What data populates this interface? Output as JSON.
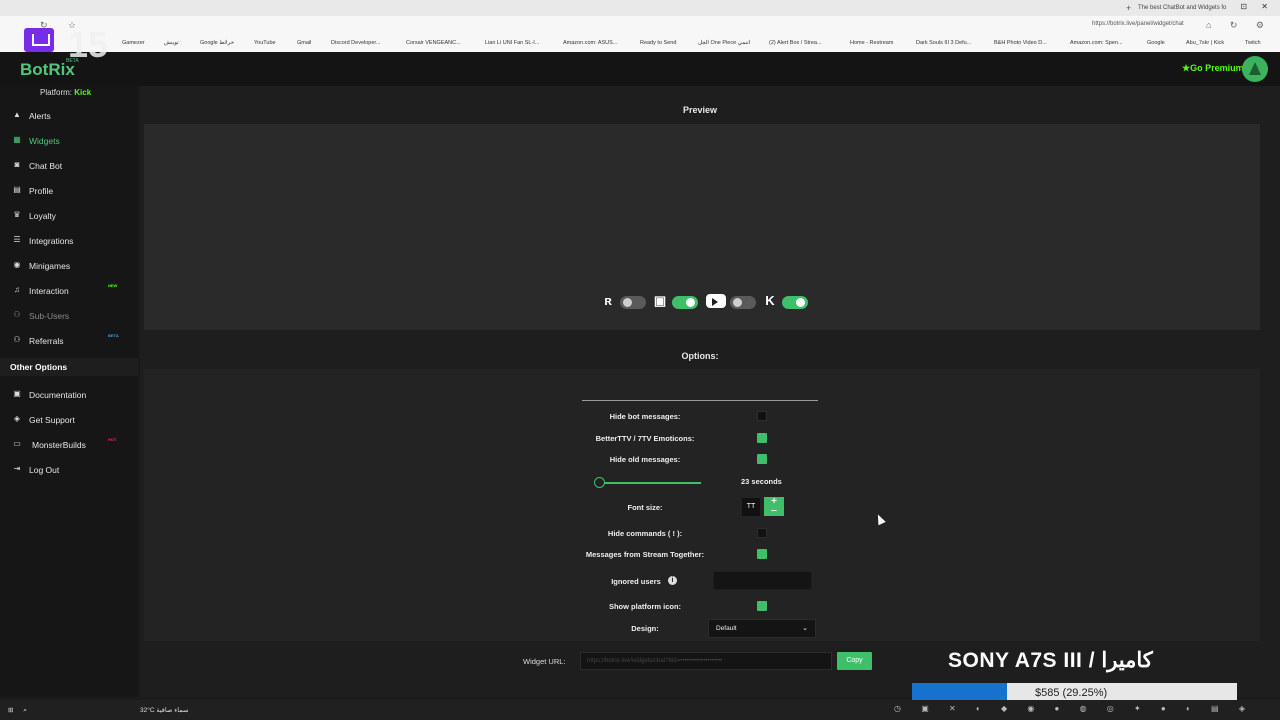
{
  "browser": {
    "active_tab": "The best ChatBot and Widgets fo",
    "url": "https://botrix.live/panel/widget/chat",
    "bookmarks": [
      "Gamezer",
      "توينش",
      "Google خرائط",
      "YouTube",
      "Gmail",
      "Discord Developer...",
      "Corsair VENGEANC...",
      "Lian Li UNI Fan SL-I...",
      "Amazon.com: ASUS...",
      "Ready to Send",
      "الجل One Piece اتنمي",
      "(2) Alert Box / Strea...",
      "Home - Restream",
      "Dark Souls III 3 Defu...",
      "B&H Photo Video D...",
      "Amazon.com: Spen...",
      "Google",
      "Abu_7skr | Kick",
      "Twitch"
    ]
  },
  "stream_counter": "15",
  "app": {
    "brand": "BotRix",
    "beta": "BETA",
    "go_premium": "Go Premium",
    "platform_label": "Platform:",
    "platform_value": "Kick"
  },
  "sidebar": {
    "items": [
      {
        "label": "Alerts",
        "icon": "warning-icon"
      },
      {
        "label": "Widgets",
        "icon": "grid-icon"
      },
      {
        "label": "Chat Bot",
        "icon": "robot-icon"
      },
      {
        "label": "Profile",
        "icon": "profile-card-icon"
      },
      {
        "label": "Loyalty",
        "icon": "trophy-icon"
      },
      {
        "label": "Integrations",
        "icon": "list-icon"
      },
      {
        "label": "Minigames",
        "icon": "gamepad-icon"
      },
      {
        "label": "Interaction",
        "icon": "music-icon",
        "badge": "NEW"
      },
      {
        "label": "Sub-Users",
        "icon": "users-icon"
      },
      {
        "label": "Referrals",
        "icon": "users-icon",
        "badge": "BETA"
      }
    ],
    "other_heading": "Other Options",
    "other_items": [
      {
        "label": "Documentation",
        "icon": "book-icon"
      },
      {
        "label": "Get Support",
        "icon": "support-icon"
      },
      {
        "label": "MonsterBuilds",
        "icon": "laptop-icon",
        "badge": "HOT"
      },
      {
        "label": "Log Out",
        "icon": "logout-icon"
      }
    ],
    "colors": {
      "active": "#4ec77a",
      "new_badge": "#53fc18",
      "beta_badge": "#3aa3e3",
      "hot_badge": "#e0334a"
    }
  },
  "main": {
    "preview_title": "Preview",
    "options_title": "Options:",
    "platforms": [
      {
        "name": "kick-alt",
        "enabled": false
      },
      {
        "name": "twitch",
        "enabled": true
      },
      {
        "name": "youtube",
        "enabled": false
      },
      {
        "name": "kick",
        "enabled": true
      }
    ],
    "options": {
      "hide_bot_label": "Hide bot messages:",
      "hide_bot": false,
      "bttv_label": "BetterTTV / 7TV Emoticons:",
      "bttv": true,
      "hide_old_label": "Hide old messages:",
      "hide_old": true,
      "seconds": "23 seconds",
      "slider_value": 0.05,
      "font_size_label": "Font size:",
      "font_dec": "TT",
      "font_inc": "+",
      "hide_commands_label": "Hide commands ( ! ):",
      "hide_commands": false,
      "stream_together_label": "Messages from Stream Together:",
      "stream_together": true,
      "ignored_users_label": "Ignored users",
      "ignored_users_value": "",
      "show_platform_label": "Show platform icon:",
      "show_platform": true,
      "design_label": "Design:",
      "design_value": "Default"
    },
    "widget_url_label": "Widget URL:",
    "widget_url_value": "https://botrix.live/widgets/chat?bid=••••••••••••••••••••",
    "copy_label": "Copy",
    "accent": "#3fbf69"
  },
  "overlay": {
    "title": "SONY A7S III / كاميرا",
    "progress_text": "$585 (29.25%)",
    "progress": 0.2925
  },
  "taskbar": {
    "weather": "32°C سماء صافية",
    "lang": "ENG"
  }
}
